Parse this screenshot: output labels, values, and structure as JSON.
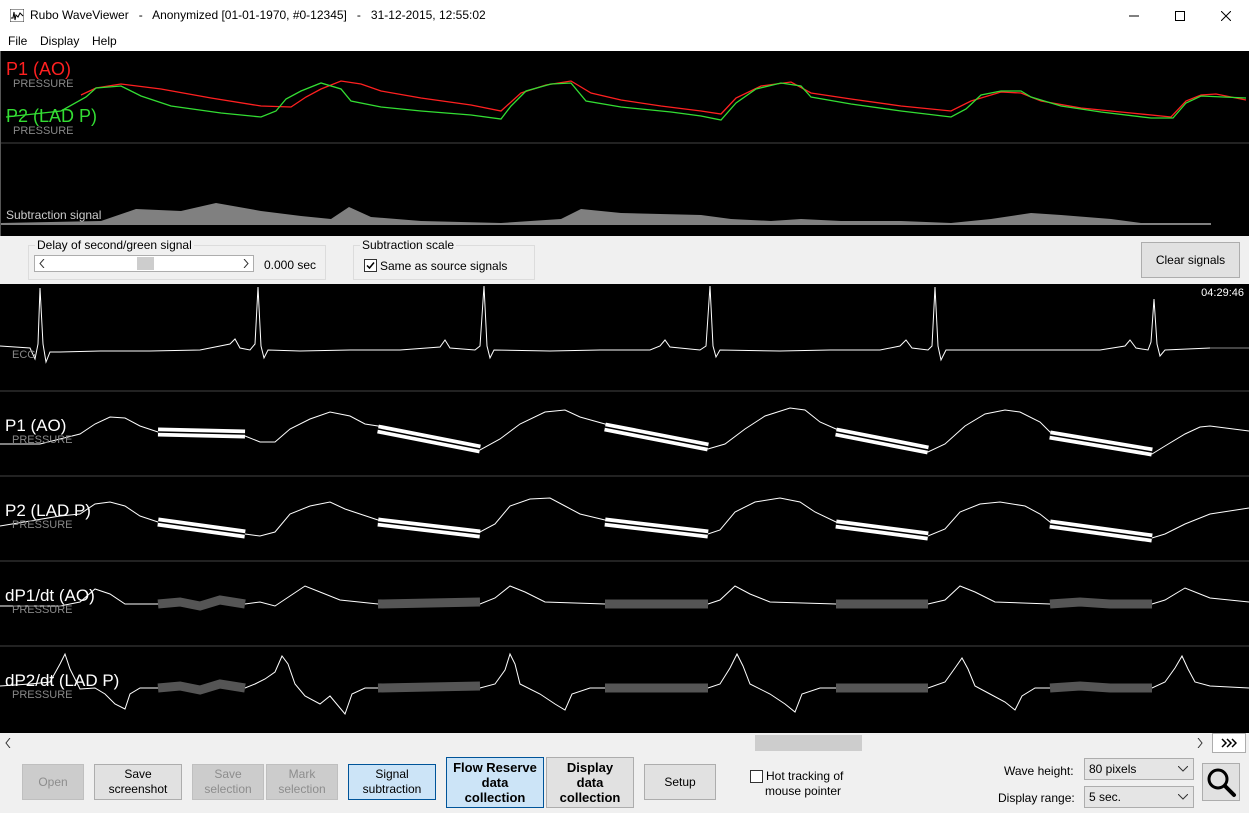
{
  "window": {
    "app_title": "Rubo WaveViewer",
    "patient": "Anonymized [01-01-1970, #0-12345]",
    "datetime": "31-12-2015, 12:55:02",
    "separator": "-"
  },
  "menu": {
    "file": "File",
    "display": "Display",
    "help": "Help"
  },
  "top_scope": {
    "p1_label": "P1  (AO)",
    "p1_sub": "PRESSURE",
    "p2_label": "P2  (LAD P)",
    "p2_sub": "PRESSURE",
    "subtraction_label": "Subtraction signal"
  },
  "controls": {
    "delay_title": "Delay of second/green signal",
    "delay_value": "0.000 sec",
    "subtraction_title": "Subtraction scale",
    "same_as_source": "Same as source signals",
    "same_as_source_checked": true,
    "clear_signals": "Clear signals"
  },
  "main_scope": {
    "time": "04:29:46",
    "ecg_label": "ECG",
    "channels": [
      {
        "label": "P1  (AO)",
        "sub": "PRESSURE"
      },
      {
        "label": "P2  (LAD P)",
        "sub": "PRESSURE"
      },
      {
        "label": "dP1/dt  (AO)",
        "sub": "PRESSURE"
      },
      {
        "label": "dP2/dt  (LAD P)",
        "sub": "PRESSURE"
      }
    ]
  },
  "toolbar": {
    "open": "Open",
    "save_screenshot_1": "Save",
    "save_screenshot_2": "screenshot",
    "save_selection_1": "Save",
    "save_selection_2": "selection",
    "mark_selection_1": "Mark",
    "mark_selection_2": "selection",
    "signal_subtraction_1": "Signal",
    "signal_subtraction_2": "subtraction",
    "flow_reserve_1": "Flow Reserve",
    "flow_reserve_2": "data",
    "flow_reserve_3": "collection",
    "display_data_1": "Display",
    "display_data_2": "data",
    "display_data_3": "collection",
    "setup": "Setup",
    "hot_tracking_1": "Hot tracking of",
    "hot_tracking_2": "mouse pointer",
    "wave_height_label": "Wave height:",
    "wave_height_value": "80 pixels",
    "display_range_label": "Display range:",
    "display_range_value": "5 sec."
  },
  "colors": {
    "p1": "#ff2020",
    "p2": "#33dd33",
    "trace": "#ffffff",
    "subtraction_fill": "#808080",
    "active_button": "#cce4f7"
  },
  "icons": [
    "app-icon",
    "minimize-icon",
    "maximize-icon",
    "close-icon",
    "scroll-left-icon",
    "scroll-right-icon",
    "fast-forward-icon",
    "chevron-down-icon",
    "magnifier-icon",
    "checkmark-icon"
  ]
}
